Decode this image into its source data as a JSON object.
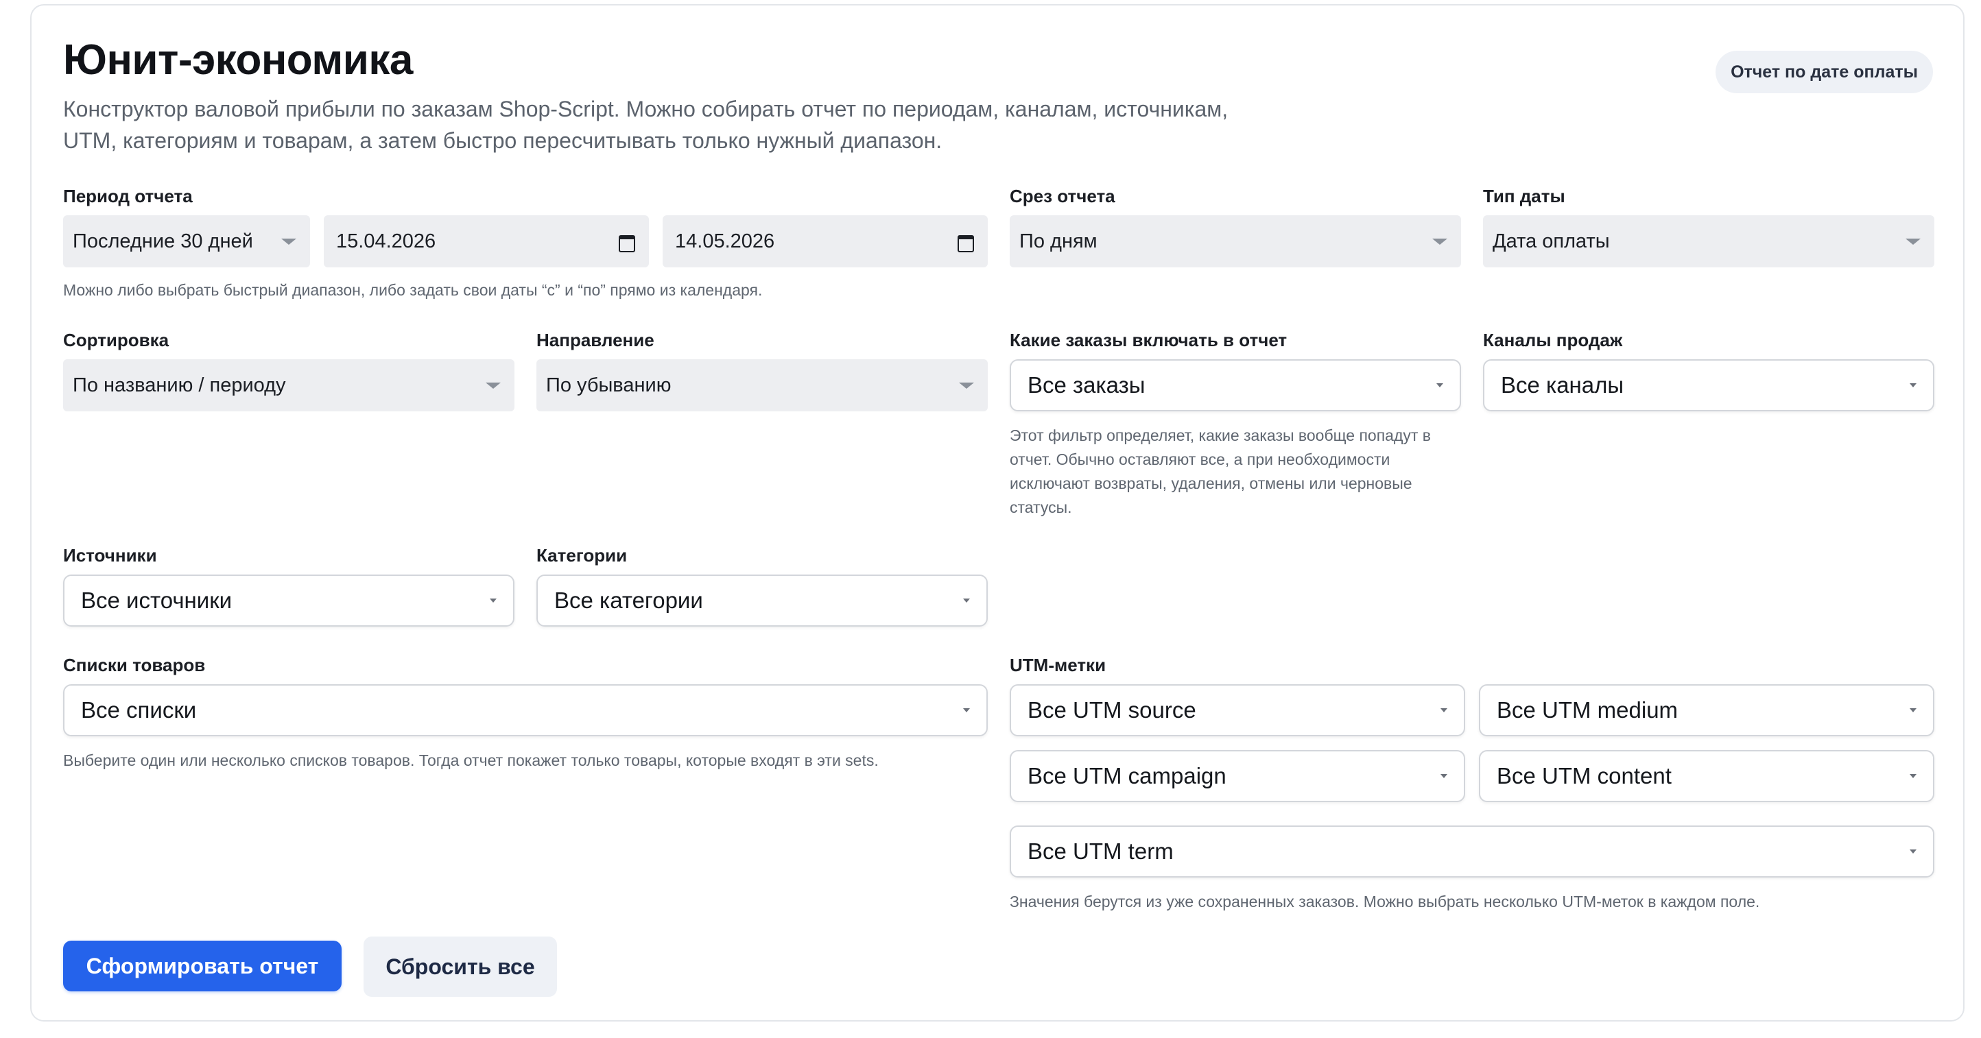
{
  "header": {
    "title": "Юнит-экономика",
    "description": "Конструктор валовой прибыли по заказам Shop-Script. Можно собирать отчет по периодам, каналам, источникам, UTM, категориям и товарам, а затем быстро пересчитывать только нужный диапазон.",
    "report_mode_label": "Отчет по дате оплаты"
  },
  "period": {
    "label": "Период отчета",
    "preset": "Последние 30 дней",
    "date_from": "15.04.2026",
    "date_to": "14.05.2026",
    "hint": "Можно либо выбрать быстрый диапазон, либо задать свои даты “с” и “по” прямо из календаря."
  },
  "slice": {
    "label": "Срез отчета",
    "value": "По дням"
  },
  "date_type": {
    "label": "Тип даты",
    "value": "Дата оплаты"
  },
  "sort": {
    "label": "Сортировка",
    "value": "По названию / периоду"
  },
  "direction": {
    "label": "Направление",
    "value": "По убыванию"
  },
  "orders": {
    "label": "Какие заказы включать в отчет",
    "value": "Все заказы",
    "hint": "Этот фильтр определяет, какие заказы вообще попадут в отчет. Обычно оставляют все, а при необходимости исключают возвраты, удаления, отмены или черновые статусы."
  },
  "channels": {
    "label": "Каналы продаж",
    "value": "Все каналы"
  },
  "sources": {
    "label": "Источники",
    "value": "Все источники"
  },
  "categories": {
    "label": "Категории",
    "value": "Все категории"
  },
  "product_lists": {
    "label": "Списки товаров",
    "value": "Все списки",
    "hint": "Выберите один или несколько списков товаров. Тогда отчет покажет только товары, которые входят в эти sets."
  },
  "utm": {
    "label": "UTM-метки",
    "source": "Все UTM source",
    "medium": "Все UTM medium",
    "campaign": "Все UTM campaign",
    "content": "Все UTM content",
    "term": "Все UTM term",
    "hint": "Значения берутся из уже сохраненных заказов. Можно выбрать несколько UTM-меток в каждом поле."
  },
  "actions": {
    "submit": "Сформировать отчет",
    "reset": "Сбросить все"
  }
}
